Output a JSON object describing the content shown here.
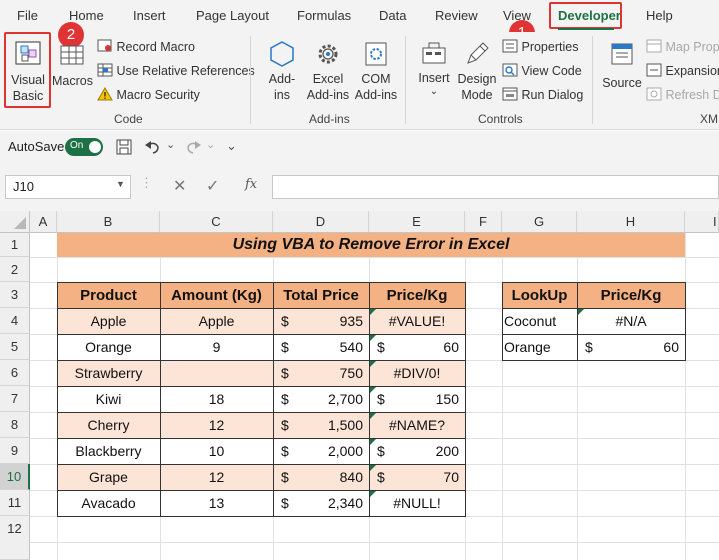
{
  "menu_tabs": [
    "File",
    "Home",
    "Insert",
    "Page Layout",
    "Formulas",
    "Data",
    "Review",
    "View",
    "Developer",
    "Help"
  ],
  "ribbon": {
    "code": {
      "visual_basic": [
        "Visual",
        "Basic"
      ],
      "macros": "Macros",
      "record_macro": "Record Macro",
      "use_relative": "Use Relative References",
      "macro_security": "Macro Security",
      "label": "Code"
    },
    "addins": {
      "addins": [
        "Add-",
        "ins"
      ],
      "excel_addins": [
        "Excel",
        "Add-ins"
      ],
      "com_addins": [
        "COM",
        "Add-ins"
      ],
      "label": "Add-ins"
    },
    "controls": {
      "insert": "Insert",
      "design_mode": [
        "Design",
        "Mode"
      ],
      "properties": "Properties",
      "view_code": "View Code",
      "run_dialog": "Run Dialog",
      "label": "Controls"
    },
    "xml": {
      "source": "Source",
      "map_properties": "Map Propert",
      "expansion_packs": "Expansion",
      "refresh_data": "Refresh Da",
      "label": "XML"
    }
  },
  "badges": [
    "1",
    "2"
  ],
  "qat": {
    "autosave": "AutoSave",
    "toggle": "On"
  },
  "formula_bar": {
    "name_box": "J10",
    "fx": "fx",
    "formula": ""
  },
  "columns": [
    "A",
    "B",
    "C",
    "D",
    "E",
    "F",
    "G",
    "H",
    "I"
  ],
  "rows": [
    "1",
    "2",
    "3",
    "4",
    "5",
    "6",
    "7",
    "8",
    "9",
    "10",
    "11",
    "12"
  ],
  "sheet": {
    "title": "Using VBA to Remove Error in Excel",
    "headers": [
      "Product",
      "Amount (Kg)",
      "Total Price",
      "Price/Kg"
    ],
    "data": [
      {
        "product": "Apple",
        "amount": "Apple",
        "currency": "$",
        "total": "935",
        "ppk_cur": "",
        "ppk": "#VALUE!"
      },
      {
        "product": "Orange",
        "amount": "9",
        "currency": "$",
        "total": "540",
        "ppk_cur": "$",
        "ppk": "60"
      },
      {
        "product": "Strawberry",
        "amount": "",
        "currency": "$",
        "total": "750",
        "ppk_cur": "",
        "ppk": "#DIV/0!"
      },
      {
        "product": "Kiwi",
        "amount": "18",
        "currency": "$",
        "total": "2,700",
        "ppk_cur": "$",
        "ppk": "150"
      },
      {
        "product": "Cherry",
        "amount": "12",
        "currency": "$",
        "total": "1,500",
        "ppk_cur": "",
        "ppk": "#NAME?"
      },
      {
        "product": "Blackberry",
        "amount": "10",
        "currency": "$",
        "total": "2,000",
        "ppk_cur": "$",
        "ppk": "200"
      },
      {
        "product": "Grape",
        "amount": "12",
        "currency": "$",
        "total": "840",
        "ppk_cur": "$",
        "ppk": "70"
      },
      {
        "product": "Avacado",
        "amount": "13",
        "currency": "$",
        "total": "2,340",
        "ppk_cur": "",
        "ppk": "#NULL!"
      }
    ],
    "lookup_headers": [
      "LookUp",
      "Price/Kg"
    ],
    "lookup": [
      {
        "name": "Coconut",
        "cur": "",
        "value": "#N/A"
      },
      {
        "name": "Orange",
        "cur": "$",
        "value": "60"
      }
    ]
  },
  "colors": {
    "accent": "#e03434",
    "header_fill": "#f4b183",
    "band_fill": "#fce4d6",
    "title_fill": "#f4b183",
    "excel_green": "#1e7145"
  }
}
